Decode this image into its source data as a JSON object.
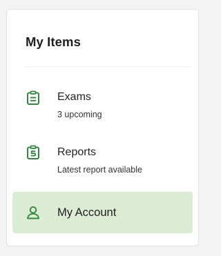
{
  "panel": {
    "title": "My Items",
    "items": [
      {
        "label": "Exams",
        "subtitle": "3 upcoming",
        "icon": "clipboard-list-icon"
      },
      {
        "label": "Reports",
        "subtitle": "Latest report available",
        "icon": "report-icon"
      },
      {
        "label": "My Account",
        "subtitle": "",
        "icon": "user-icon",
        "selected": true
      }
    ]
  },
  "colors": {
    "accent": "#2f8a3c",
    "selected_bg": "#dcebd4"
  }
}
